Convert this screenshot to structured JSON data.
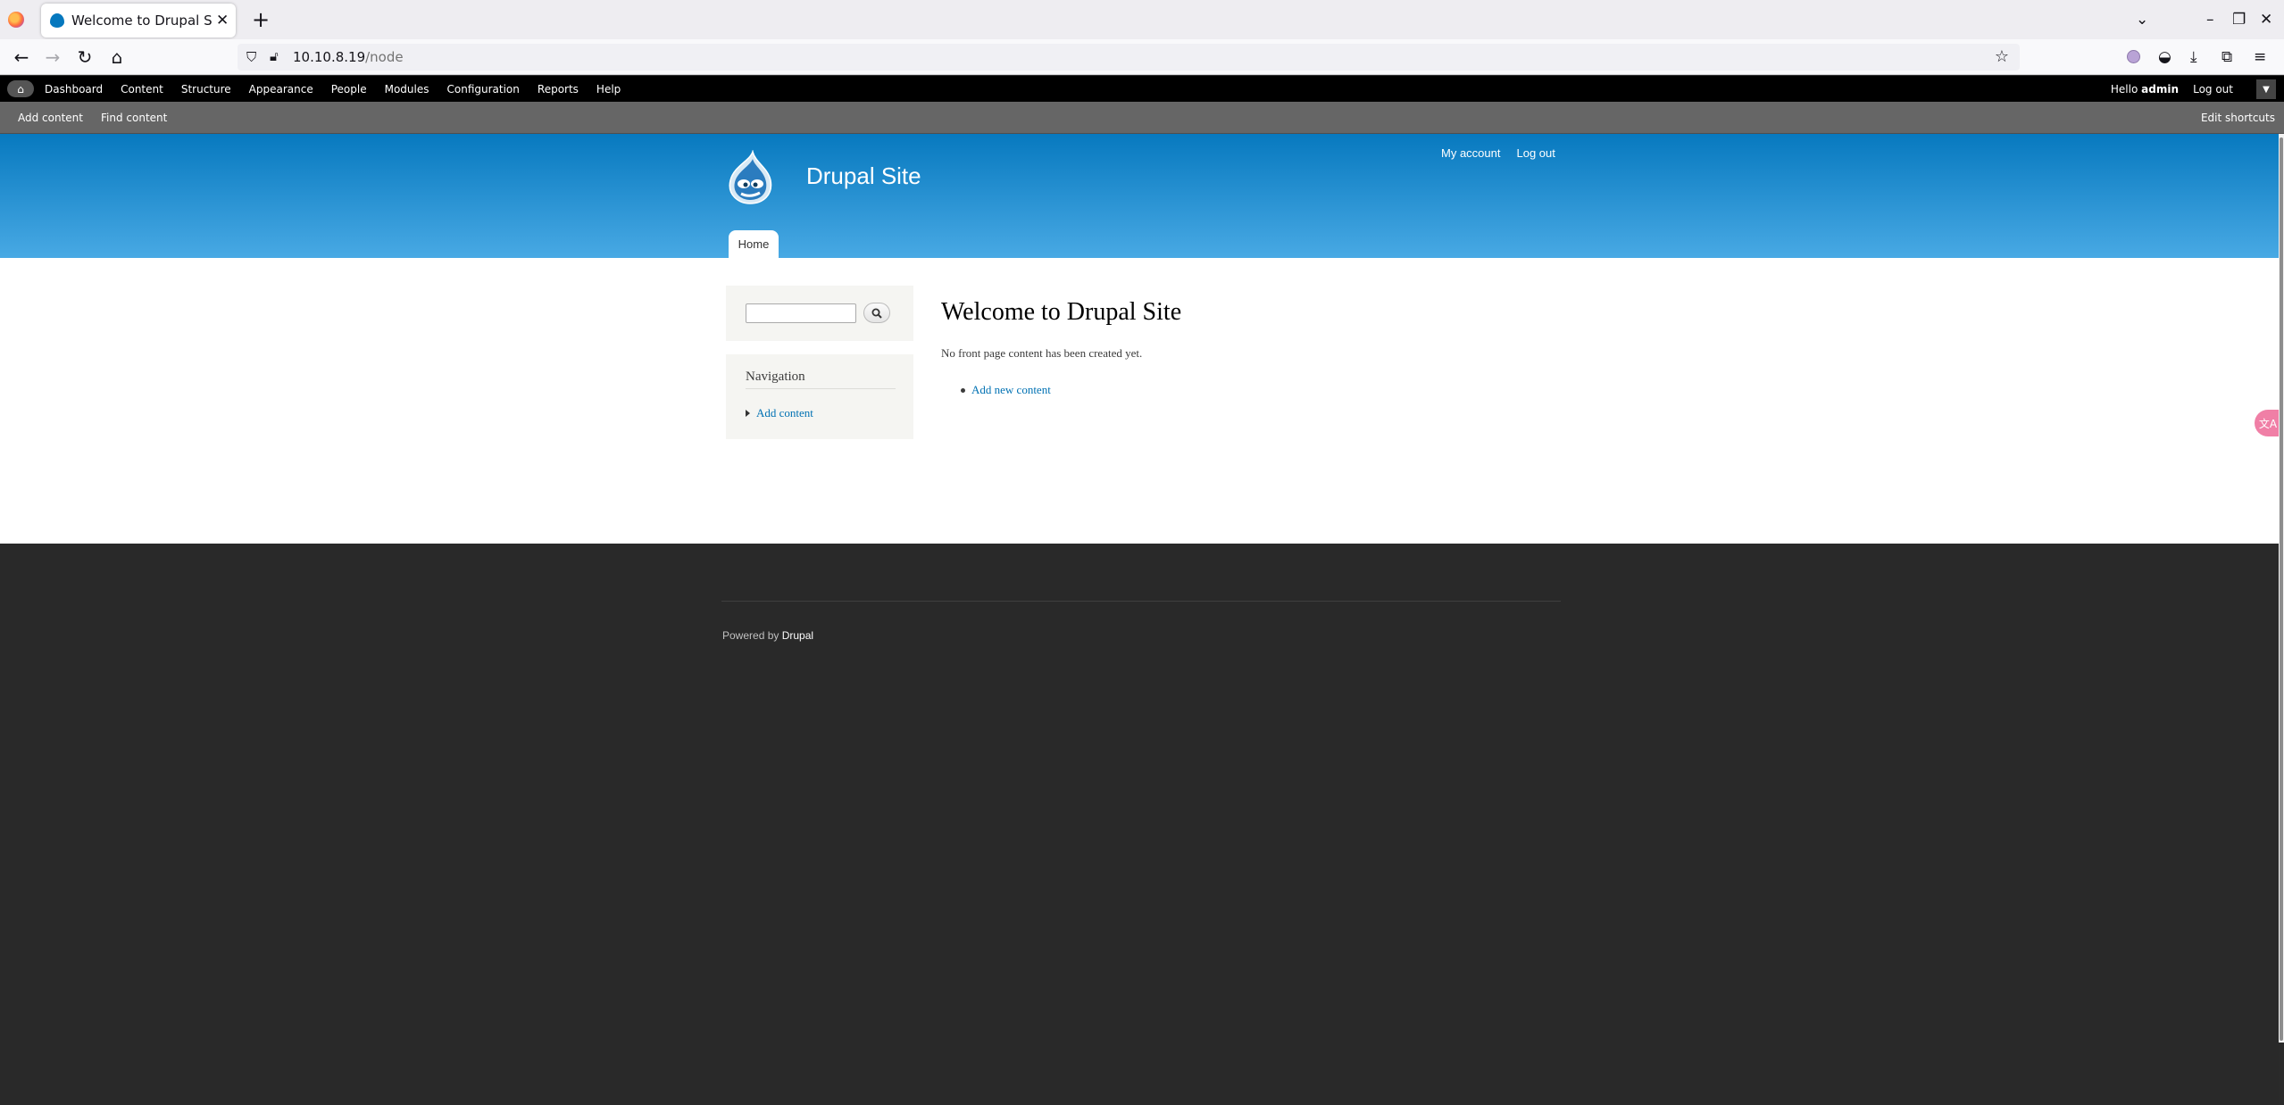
{
  "browser": {
    "tab_title": "Welcome to Drupal Site |",
    "tab_close": "✕",
    "new_tab": "+",
    "url_host": "10.10.8.19",
    "url_path": "/node"
  },
  "toolbar": {
    "menu": [
      "Dashboard",
      "Content",
      "Structure",
      "Appearance",
      "People",
      "Modules",
      "Configuration",
      "Reports",
      "Help"
    ],
    "hello": "Hello",
    "username": "admin",
    "logout": "Log out"
  },
  "shortcuts": {
    "add_content": "Add content",
    "find_content": "Find content",
    "edit_shortcuts": "Edit shortcuts"
  },
  "header": {
    "site_name": "Drupal Site",
    "my_account": "My account",
    "log_out": "Log out",
    "tab_home": "Home"
  },
  "sidebar": {
    "search_value": "",
    "nav_title": "Navigation",
    "nav_add_content": "Add content"
  },
  "main": {
    "title": "Welcome to Drupal Site",
    "intro": "No front page content has been created yet.",
    "add_new_content": "Add new content"
  },
  "footer": {
    "powered_by": "Powered by",
    "drupal_link": "Drupal"
  },
  "colors": {
    "header_top": "#0779bf",
    "header_bottom": "#48a9e4",
    "link": "#0071b3",
    "footer_bg": "#292929"
  }
}
